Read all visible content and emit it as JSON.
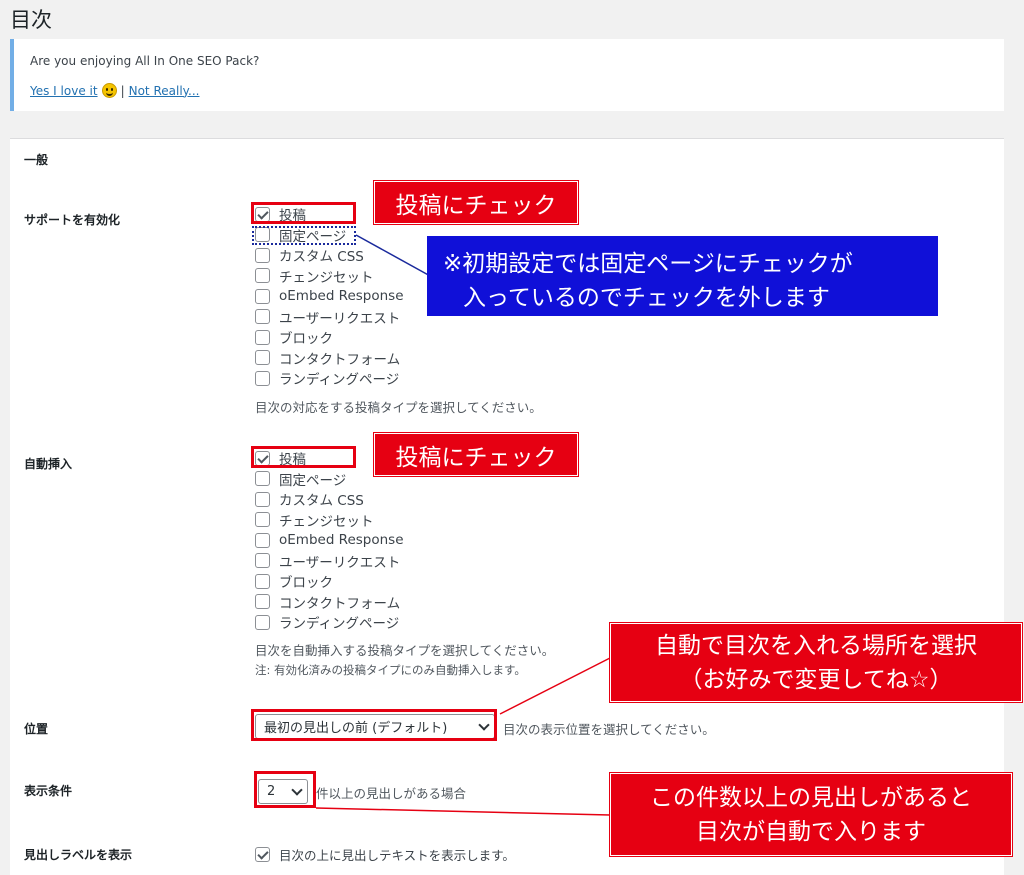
{
  "header": {
    "title": "目次"
  },
  "notice": {
    "question": "Are you enjoying All In One SEO Pack?",
    "yes_link": "Yes I love it",
    "separator": "|",
    "no_link": "Not Really..."
  },
  "section": {
    "heading": "一般"
  },
  "support": {
    "label": "サポートを有効化",
    "options": [
      {
        "label": "投稿",
        "checked": true
      },
      {
        "label": "固定ページ",
        "checked": false
      },
      {
        "label": "カスタム CSS",
        "checked": false
      },
      {
        "label": "チェンジセット",
        "checked": false
      },
      {
        "label": "oEmbed Response",
        "checked": false
      },
      {
        "label": "ユーザーリクエスト",
        "checked": false
      },
      {
        "label": "ブロック",
        "checked": false
      },
      {
        "label": "コンタクトフォーム",
        "checked": false
      },
      {
        "label": "ランディングページ",
        "checked": false
      }
    ],
    "description": "目次の対応をする投稿タイプを選択してください。"
  },
  "auto_insert": {
    "label": "自動挿入",
    "options": [
      {
        "label": "投稿",
        "checked": true
      },
      {
        "label": "固定ページ",
        "checked": false
      },
      {
        "label": "カスタム CSS",
        "checked": false
      },
      {
        "label": "チェンジセット",
        "checked": false
      },
      {
        "label": "oEmbed Response",
        "checked": false
      },
      {
        "label": "ユーザーリクエスト",
        "checked": false
      },
      {
        "label": "ブロック",
        "checked": false
      },
      {
        "label": "コンタクトフォーム",
        "checked": false
      },
      {
        "label": "ランディングページ",
        "checked": false
      }
    ],
    "description": "目次を自動挿入する投稿タイプを選択してください。",
    "note": "注: 有効化済みの投稿タイプにのみ自動挿入します。"
  },
  "position": {
    "label": "位置",
    "selected": "最初の見出しの前 (デフォルト)",
    "description": "目次の表示位置を選択してください。"
  },
  "display_condition": {
    "label": "表示条件",
    "selected": "2",
    "description": "件以上の見出しがある場合"
  },
  "heading_label": {
    "label": "見出しラベルを表示",
    "checked": true,
    "description": "目次の上に見出しテキストを表示します。"
  },
  "annotations": {
    "check_post_1": "投稿にチェック",
    "fixed_page_note_line1": "※初期設定では固定ページにチェックが",
    "fixed_page_note_line2": "入っているのでチェックを外します",
    "check_post_2": "投稿にチェック",
    "position_note_line1": "自動で目次を入れる場所を選択",
    "position_note_line2": "（お好みで変更してね☆）",
    "count_note_line1": "この件数以上の見出しがあると",
    "count_note_line2": "目次が自動で入ります"
  },
  "colors": {
    "annotation_red": "#e60012",
    "annotation_blue": "#1010d8",
    "link": "#2271b1",
    "notice_border": "#72aee6"
  }
}
